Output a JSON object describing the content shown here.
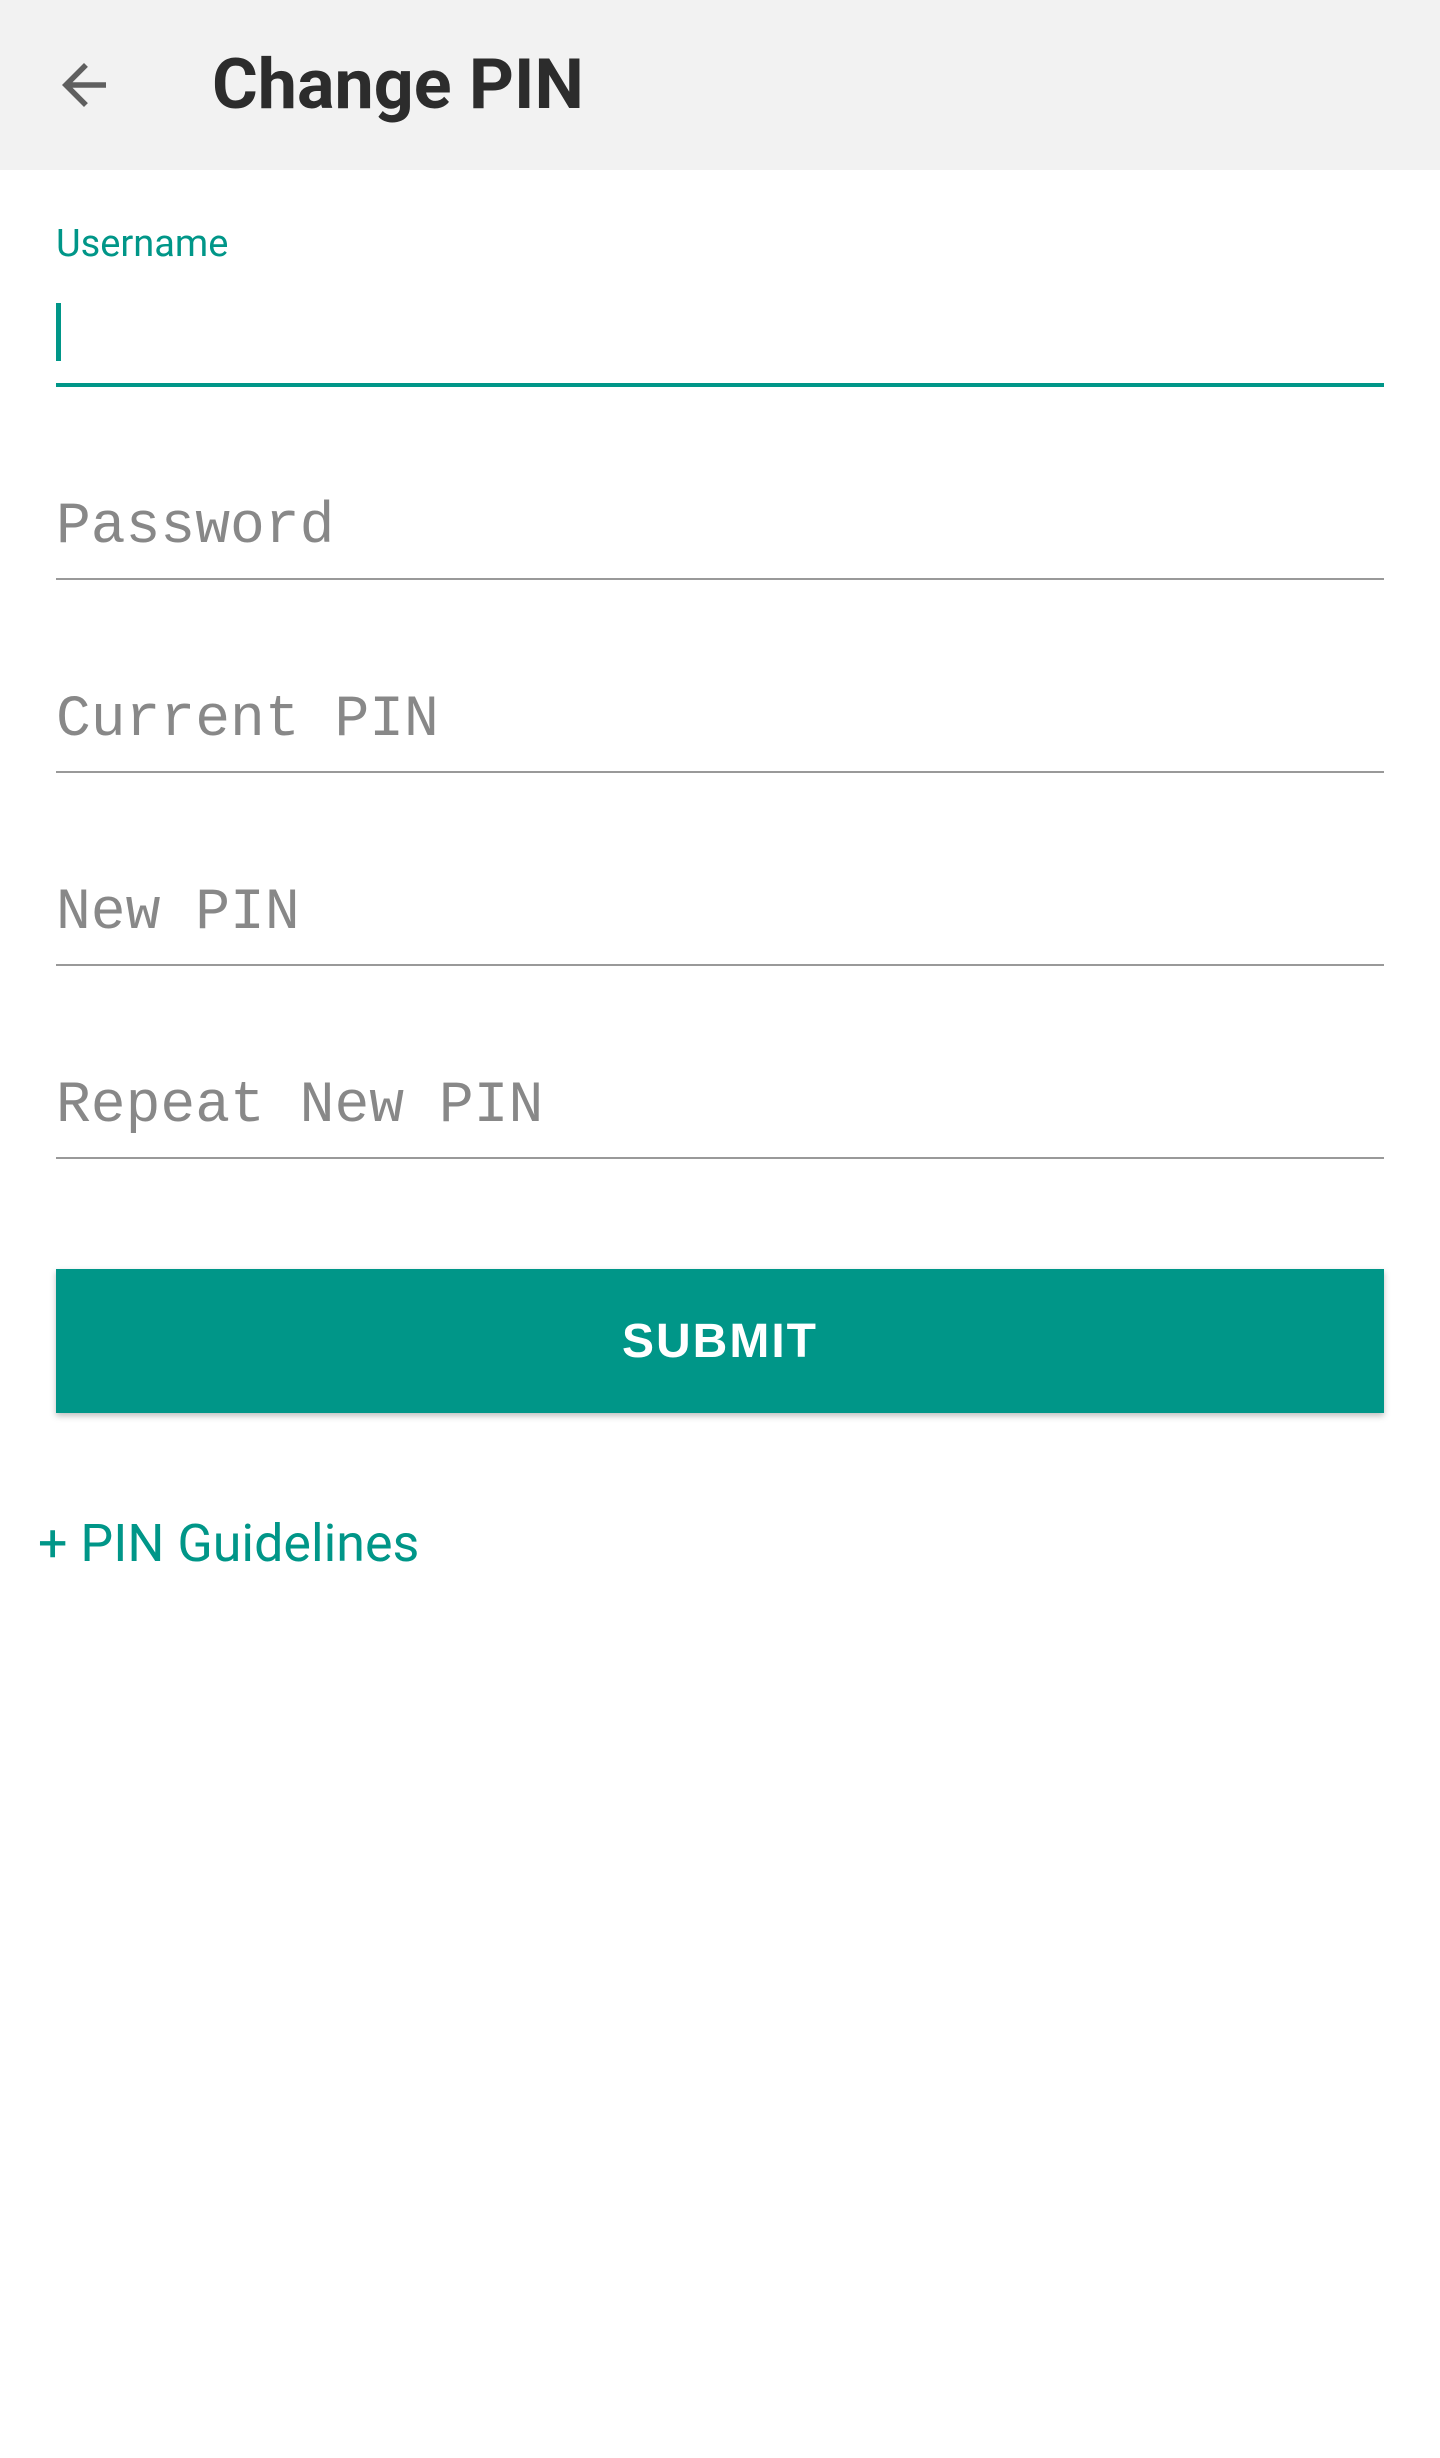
{
  "header": {
    "title": "Change PIN"
  },
  "fields": {
    "username": {
      "label": "Username",
      "value": ""
    },
    "password": {
      "placeholder": "Password",
      "value": ""
    },
    "current_pin": {
      "placeholder": "Current PIN",
      "value": ""
    },
    "new_pin": {
      "placeholder": "New PIN",
      "value": ""
    },
    "repeat_new_pin": {
      "placeholder": "Repeat New PIN",
      "value": ""
    }
  },
  "submit_label": "SUBMIT",
  "guidelines_link": "+ PIN Guidelines",
  "colors": {
    "accent": "#009688",
    "header_bg": "#f2f2f2",
    "placeholder": "#888888"
  }
}
